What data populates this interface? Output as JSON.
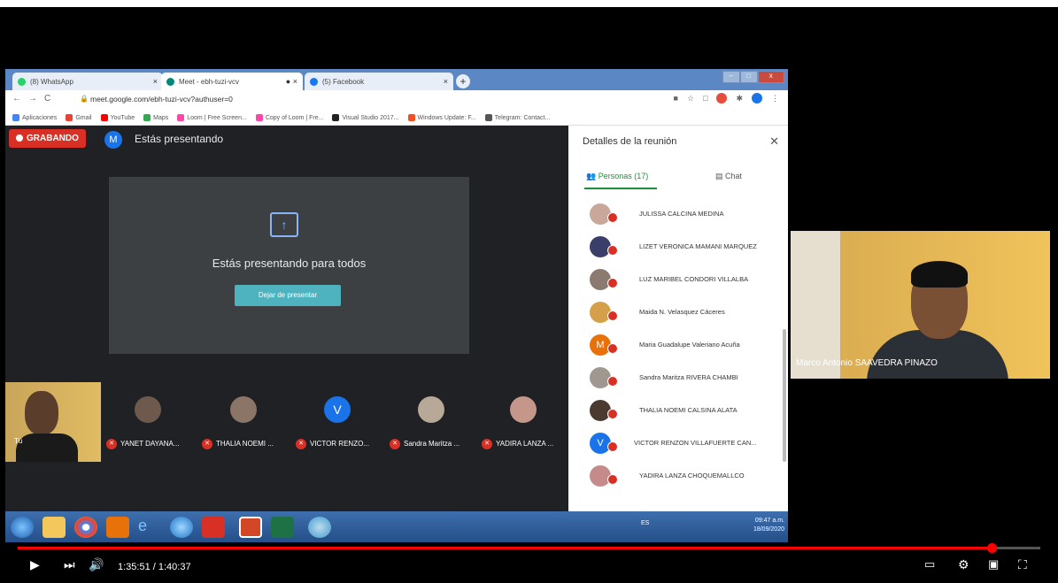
{
  "browser": {
    "tabs": [
      {
        "label": "(8) WhatsApp",
        "color": "#25d366"
      },
      {
        "label": "Meet - ebh-tuzi-vcv",
        "color": "#00897b"
      },
      {
        "label": "(5) Facebook",
        "color": "#1877f2"
      }
    ],
    "url": "meet.google.com/ebh-tuzi-vcv?authuser=0",
    "bookmarks": [
      "Aplicaciones",
      "Gmail",
      "YouTube",
      "Maps",
      "Loom | Free Screen...",
      "Copy of Loom | Fre...",
      "Visual Studio 2017...",
      "Windows Update: F...",
      "Telegram: Contact..."
    ]
  },
  "meet": {
    "recording_label": "GRABANDO",
    "user_initial": "M",
    "presenting_label": "Estás presentando",
    "present_card_title": "Estás presentando para todos",
    "stop_presenting_label": "Dejar de presentar",
    "self_label": "Tú",
    "thumbnails": [
      {
        "name": "YANET DAYANA...",
        "initial": ""
      },
      {
        "name": "THALIA NOEMI ...",
        "initial": ""
      },
      {
        "name": "VICTOR RENZO...",
        "initial": "V"
      },
      {
        "name": "Sandra Maritza ...",
        "initial": ""
      },
      {
        "name": "YADIRA LANZA ...",
        "initial": ""
      }
    ]
  },
  "panel": {
    "title": "Detalles de la reunión",
    "people_tab": "Personas (17)",
    "chat_tab": "Chat",
    "participants": [
      {
        "name": "JULISSA CALCINA MEDINA",
        "initial": ""
      },
      {
        "name": "LIZET VERONICA MAMANI MARQUEZ",
        "initial": ""
      },
      {
        "name": "LUZ MARIBEL CONDORI VILLALBA",
        "initial": ""
      },
      {
        "name": "Maida N. Velasquez Cáceres",
        "initial": ""
      },
      {
        "name": "Maria Guadalupe Valeriano Acuña",
        "initial": "M"
      },
      {
        "name": "Sandra Maritza RIVERA CHAMBI",
        "initial": ""
      },
      {
        "name": "THALIA NOEMI CALSINA ALATA",
        "initial": ""
      },
      {
        "name": "VICTOR RENZON VILLAFUERTE CAN...",
        "initial": "V"
      },
      {
        "name": "YADIRA LANZA CHOQUEMALLCO",
        "initial": ""
      }
    ]
  },
  "taskbar": {
    "lang": "ES",
    "time": "09:47 a.m.",
    "date": "18/09/2020"
  },
  "presenter": {
    "name": "Marco Antonio SAAVEDRA PINAZO"
  },
  "player": {
    "time_display": "1:35:51 / 1:40:37",
    "progress": 0.952
  }
}
